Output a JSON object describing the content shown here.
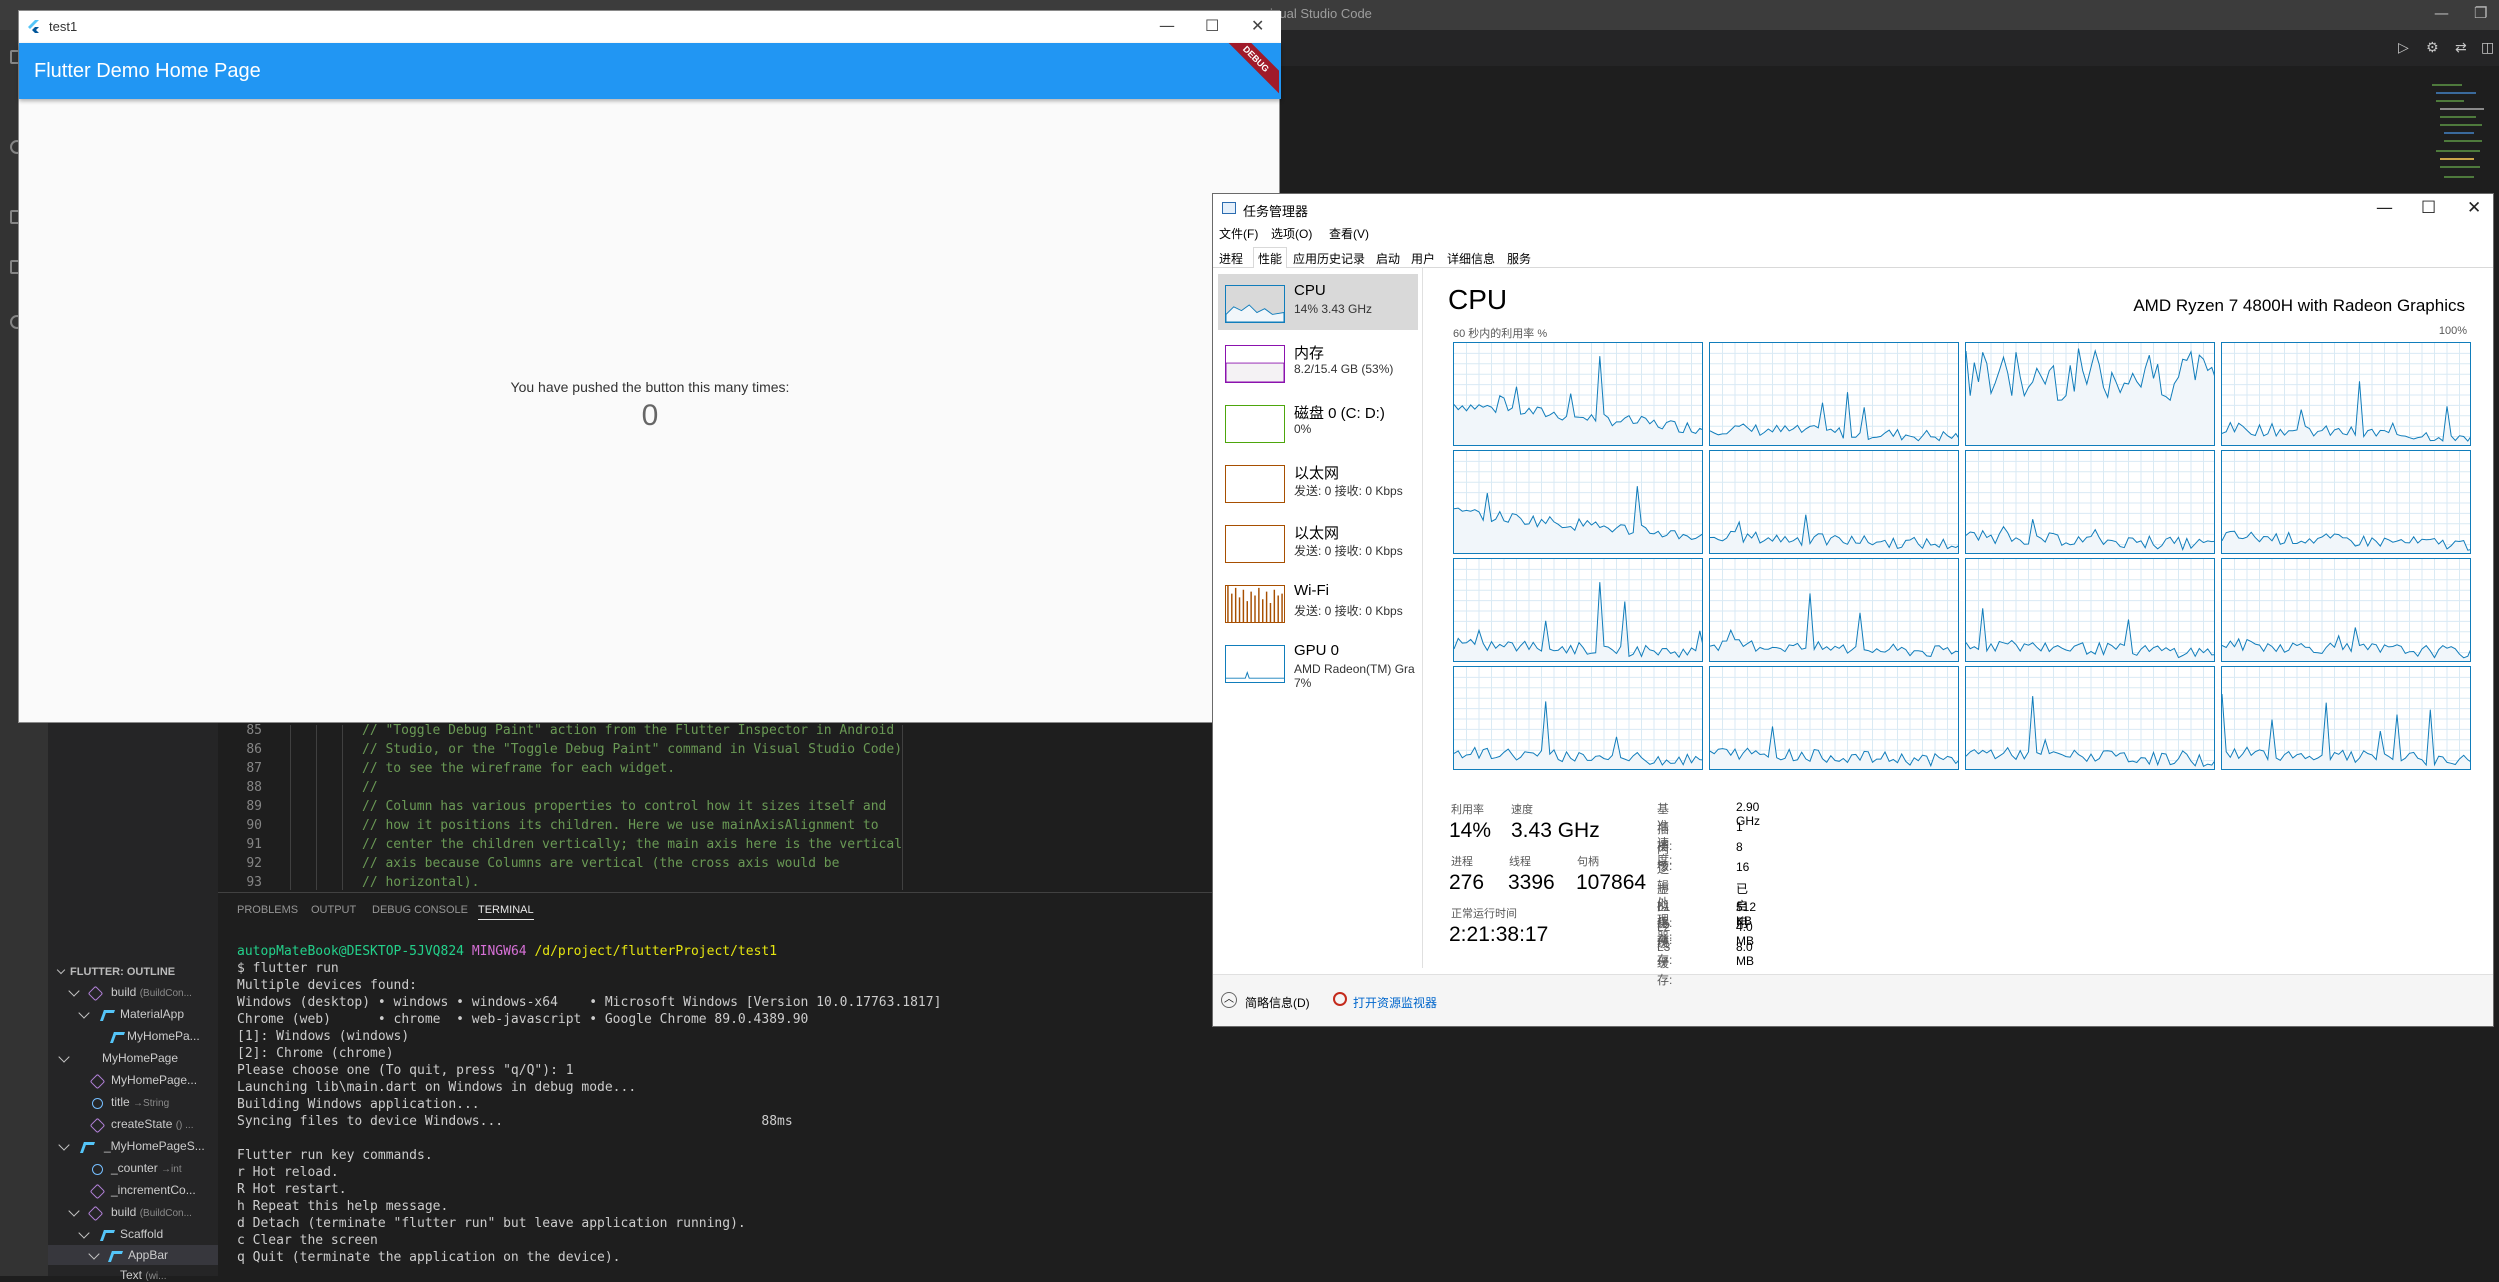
{
  "vscode": {
    "title": "isual Studio Code",
    "outline_header": "FLUTTER: OUTLINE",
    "outline": [
      {
        "label": "build",
        "type": "(BuildCon..."
      },
      {
        "label": "MaterialApp",
        "type": ""
      },
      {
        "label": "MyHomePa...",
        "type": ""
      },
      {
        "label": "MyHomePage",
        "type": ""
      },
      {
        "label": "MyHomePage...",
        "type": ""
      },
      {
        "label": "title",
        "type": "→String"
      },
      {
        "label": "createState",
        "type": "() ..."
      },
      {
        "label": "_MyHomePageS...",
        "type": ""
      },
      {
        "label": "_counter",
        "type": "→int"
      },
      {
        "label": "_incrementCo...",
        "type": ""
      },
      {
        "label": "build",
        "type": "(BuildCon..."
      },
      {
        "label": "Scaffold",
        "type": ""
      },
      {
        "label": "AppBar",
        "type": ""
      },
      {
        "label": "Text",
        "type": "(wi..."
      }
    ],
    "code_lines": [
      {
        "n": "85",
        "text": "// \"Toggle Debug Paint\" action from the Flutter Inspector in Android"
      },
      {
        "n": "86",
        "text": "// Studio, or the \"Toggle Debug Paint\" command in Visual Studio Code)"
      },
      {
        "n": "87",
        "text": "// to see the wireframe for each widget."
      },
      {
        "n": "88",
        "text": "//"
      },
      {
        "n": "89",
        "text": "// Column has various properties to control how it sizes itself and"
      },
      {
        "n": "90",
        "text": "// how it positions its children. Here we use mainAxisAlignment to"
      },
      {
        "n": "91",
        "text": "// center the children vertically; the main axis here is the vertical"
      },
      {
        "n": "92",
        "text": "// axis because Columns are vertical (the cross axis would be"
      },
      {
        "n": "93",
        "text": "// horizontal)."
      }
    ],
    "panel_tabs": [
      "PROBLEMS",
      "OUTPUT",
      "DEBUG CONSOLE",
      "TERMINAL"
    ],
    "terminal": {
      "prompt_user": "autopMateBook@DESKTOP-5JVQ824",
      "prompt_shell": "MINGW64",
      "prompt_path": "/d/project/flutterProject/test1",
      "lines": [
        "$ flutter run",
        "Multiple devices found:",
        "Windows (desktop) • windows • windows-x64    • Microsoft Windows [Version 10.0.17763.1817]",
        "Chrome (web)      • chrome  • web-javascript • Google Chrome 89.0.4389.90",
        "[1]: Windows (windows)",
        "[2]: Chrome (chrome)",
        "Please choose one (To quit, press \"q/Q\"): 1",
        "Launching lib\\main.dart on Windows in debug mode...",
        "Building Windows application...",
        "Syncing files to device Windows...                                 88ms",
        "",
        "Flutter run key commands.",
        "r Hot reload.",
        "R Hot restart.",
        "h Repeat this help message.",
        "d Detach (terminate \"flutter run\" but leave application running).",
        "c Clear the screen",
        "q Quit (terminate the application on the device)."
      ]
    }
  },
  "flutter": {
    "window_title": "test1",
    "appbar_title": "Flutter Demo Home Page",
    "debug_banner": "DEBUG",
    "message": "You have pushed the button this many times:",
    "counter": "0"
  },
  "taskmanager": {
    "title": "任务管理器",
    "menu": [
      "文件(F)",
      "选项(O)",
      "查看(V)"
    ],
    "tabs": [
      "进程",
      "性能",
      "应用历史记录",
      "启动",
      "用户",
      "详细信息",
      "服务"
    ],
    "resources": [
      {
        "name": "CPU",
        "sub": "14% 3.43 GHz",
        "color": "#117dbb"
      },
      {
        "name": "内存",
        "sub": "8.2/15.4 GB (53%)",
        "color": "#8b12ae"
      },
      {
        "name": "磁盘 0 (C: D:)",
        "sub": "0%",
        "color": "#4da60c"
      },
      {
        "name": "以太网",
        "sub": "发送: 0 接收: 0 Kbps",
        "color": "#a74f01"
      },
      {
        "name": "以太网",
        "sub": "发送: 0 接收: 0 Kbps",
        "color": "#a74f01"
      },
      {
        "name": "Wi-Fi",
        "sub": "发送: 0 接收: 0 Kbps",
        "color": "#a74f01"
      },
      {
        "name": "GPU 0",
        "sub": "AMD Radeon(TM) Gra",
        "sub2": "7%",
        "color": "#117dbb"
      }
    ],
    "cpu_heading": "CPU",
    "cpu_model": "AMD Ryzen 7 4800H with Radeon Graphics",
    "graph_caption": "60 秒内的利用率 %",
    "graph_max": "100%",
    "stats": {
      "util_label": "利用率",
      "util": "14%",
      "speed_label": "速度",
      "speed": "3.43 GHz",
      "proc_label": "进程",
      "proc": "276",
      "thread_label": "线程",
      "thread": "3396",
      "handle_label": "句柄",
      "handle": "107864",
      "uptime_label": "正常运行时间",
      "uptime": "2:21:38:17"
    },
    "details": [
      {
        "k": "基准速度:",
        "v": "2.90 GHz"
      },
      {
        "k": "插槽:",
        "v": "1"
      },
      {
        "k": "内核:",
        "v": "8"
      },
      {
        "k": "逻辑处理器:",
        "v": "16"
      },
      {
        "k": "虚拟化:",
        "v": "已启用"
      },
      {
        "k": "L1 缓存:",
        "v": "512 KB"
      },
      {
        "k": "L2 缓存:",
        "v": "4.0 MB"
      },
      {
        "k": "L3 缓存:",
        "v": "8.0 MB"
      }
    ],
    "footer_brief": "简略信息(D)",
    "footer_monitor": "打开资源监视器"
  }
}
